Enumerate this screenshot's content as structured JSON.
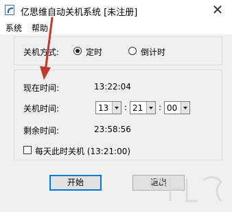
{
  "window": {
    "title": "亿思维自动关机系统 [未注册]",
    "close_glyph": "✕"
  },
  "menu": {
    "items": [
      "系统",
      "帮助"
    ]
  },
  "mode": {
    "label": "关机方式:",
    "options": [
      "定时",
      "倒计时"
    ],
    "selected": "定时"
  },
  "info": {
    "current_time_label": "现在时间:",
    "current_time_value": "13:22:04",
    "shutdown_time_label": "关机时间:",
    "hour": "13",
    "minute": "21",
    "second": "00",
    "colon": ":",
    "remaining_label": "剩余时间:",
    "remaining_value": "23:58:56"
  },
  "daily": {
    "label": "每天此时关机 (13:21:00)",
    "checked": false
  },
  "buttons": {
    "start": "开始",
    "exit": "退出"
  },
  "annotation": {
    "arrow_color": "#c0392b"
  }
}
